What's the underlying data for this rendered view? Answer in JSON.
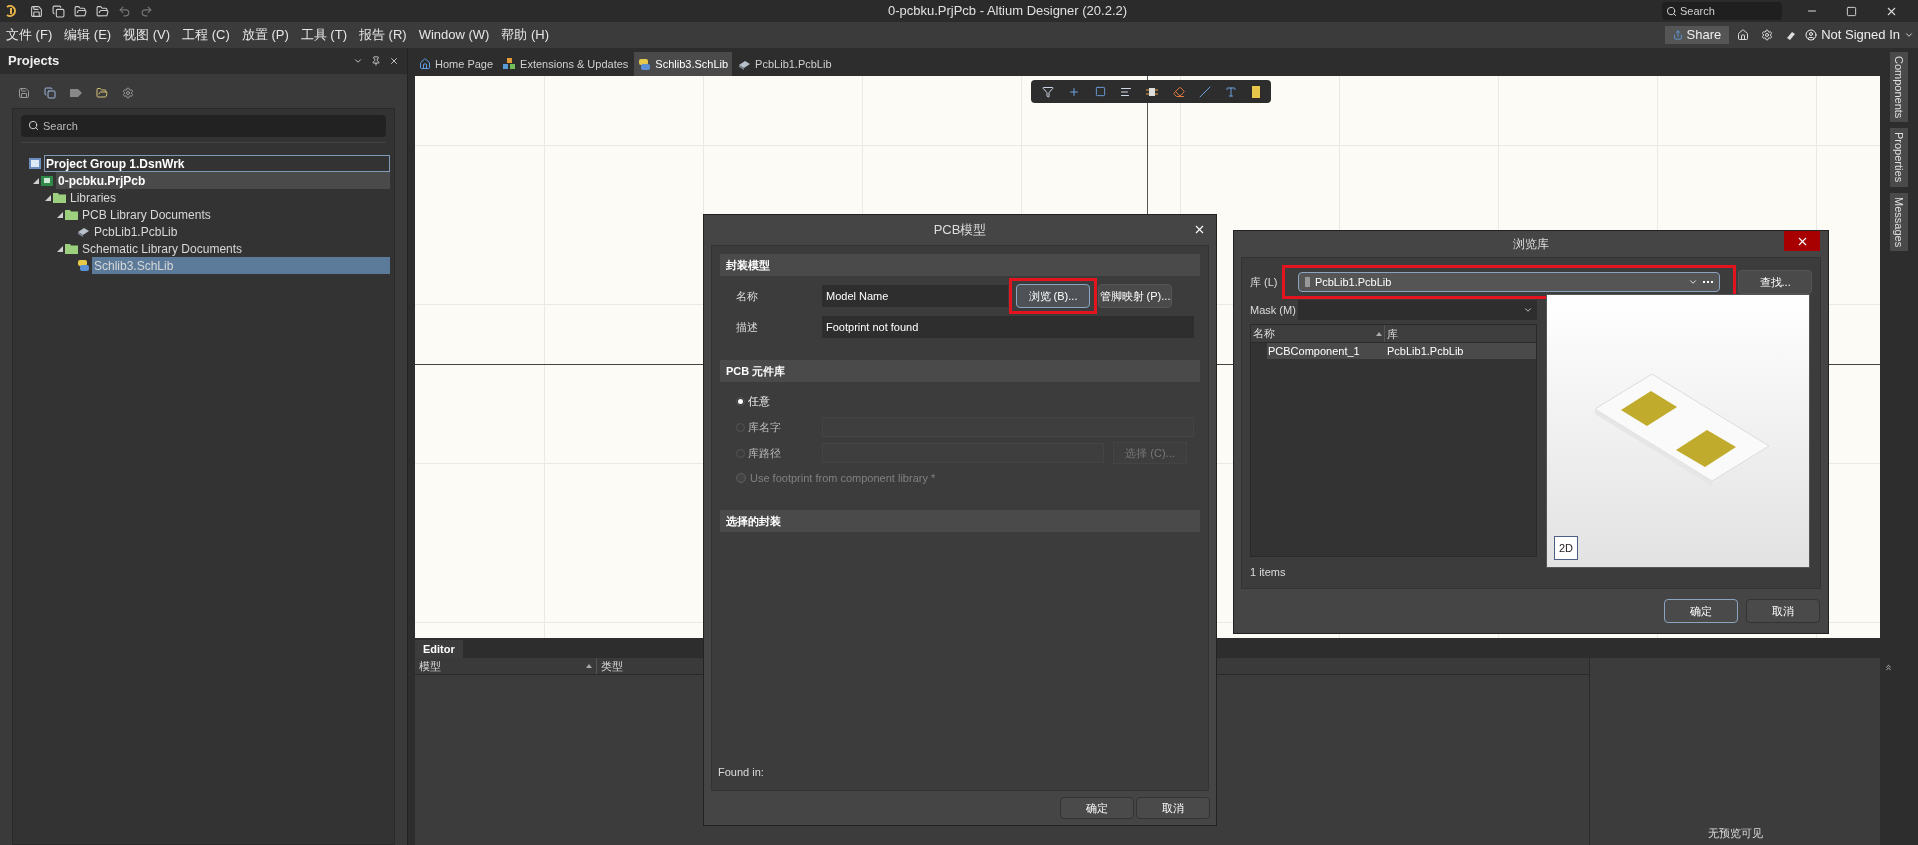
{
  "window": {
    "title": "0-pcbku.PrjPcb - Altium Designer (20.2.2)",
    "search": {
      "placeholder": "Search"
    }
  },
  "menu": [
    "文件 (F)",
    "编辑 (E)",
    "视图 (V)",
    "工程 (C)",
    "放置 (P)",
    "工具 (T)",
    "报告 (R)",
    "Window (W)",
    "帮助 (H)"
  ],
  "account": {
    "share": "Share",
    "user": "Not Signed In"
  },
  "projects_panel": {
    "title": "Projects",
    "search": {
      "placeholder": "Search"
    },
    "tree": [
      {
        "label": "Project Group 1.DsnWrk",
        "kind": "workspace",
        "selected": false,
        "focused": true,
        "bold": true,
        "children": [
          {
            "label": "0-pcbku.PrjPcb",
            "kind": "project",
            "selected": false,
            "bold": true,
            "expanded": true,
            "children": [
              {
                "label": "Libraries",
                "kind": "folder",
                "selected": false,
                "expanded": true,
                "children": [
                  {
                    "label": "PCB Library Documents",
                    "kind": "folder",
                    "selected": false,
                    "expanded": true,
                    "children": [
                      {
                        "label": "PcbLib1.PcbLib",
                        "kind": "pcblib",
                        "selected": false
                      }
                    ]
                  },
                  {
                    "label": "Schematic Library Documents",
                    "kind": "folder",
                    "selected": false,
                    "expanded": true,
                    "children": [
                      {
                        "label": "Schlib3.SchLib",
                        "kind": "schlib",
                        "selected": true
                      }
                    ]
                  }
                ]
              }
            ]
          }
        ]
      }
    ]
  },
  "document_tabs": [
    {
      "label": "Home Page",
      "kind": "home",
      "selected": false
    },
    {
      "label": "Extensions & Updates",
      "kind": "extensions",
      "selected": false
    },
    {
      "label": "Schlib3.SchLib",
      "kind": "schlib",
      "selected": true
    },
    {
      "label": "PcbLib1.PcbLib",
      "kind": "pcblib",
      "selected": false
    }
  ],
  "side_tabs": [
    "Components",
    "Properties",
    "Messages"
  ],
  "editor_panel": {
    "tab": "Editor",
    "columns": [
      "模型",
      "类型"
    ],
    "preview_text": "无预览可见"
  },
  "pcb_model_dialog": {
    "title": "PCB模型",
    "footprint_section": {
      "title": "封装模型",
      "name_label": "名称",
      "name_value": "Model Name",
      "browse_button": "浏览 (B)...",
      "pin_map_button": "管脚映射 (P)...",
      "description_label": "描述",
      "description_value": "Footprint not found"
    },
    "library_section": {
      "title": "PCB 元件库",
      "options": [
        {
          "kind": "radio",
          "label": "任意",
          "selected": true
        },
        {
          "kind": "radio",
          "label": "库名字",
          "selected": false,
          "field": true
        },
        {
          "kind": "radio",
          "label": "库路径",
          "selected": false,
          "field": true,
          "button": "选择 (C)..."
        },
        {
          "kind": "checkbox",
          "label": "Use footprint from component library *",
          "checked": false,
          "disabled": true
        }
      ]
    },
    "selected_section": {
      "title": "选择的封装"
    },
    "found_in": "Found in:",
    "ok": "确定",
    "cancel": "取消"
  },
  "browse_library_dialog": {
    "title": "浏览库",
    "library_label": "库 (L)",
    "library_value": "PcbLib1.PcbLib",
    "find_button": "查找...",
    "mask_label": "Mask (M)",
    "columns": [
      "名称",
      "库"
    ],
    "rows": [
      {
        "cells": [
          "PCBComponent_1",
          "PcbLib1.PcbLib"
        ],
        "selected": true
      }
    ],
    "count": "1 items",
    "view_button": "2D",
    "ok": "确定",
    "cancel": "取消"
  }
}
